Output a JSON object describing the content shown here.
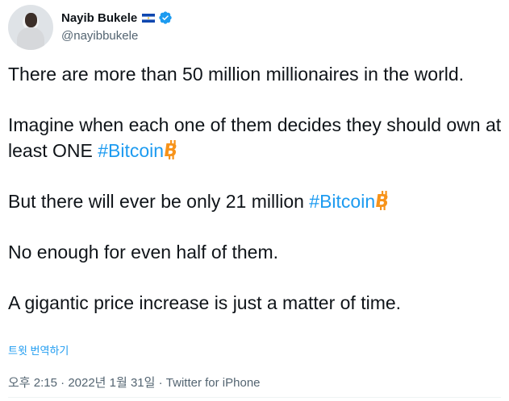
{
  "author": {
    "name": "Nayib Bukele",
    "handle": "@nayibbukele",
    "flag": "el-salvador-flag-icon",
    "verified_icon": "verified-badge-icon"
  },
  "tweet": {
    "paragraph1": "There are more than 50 million millionaires in the world.",
    "paragraph2_text": "Imagine when each one of them decides they should own at least ONE ",
    "paragraph2_hashtag": "#Bitcoin",
    "paragraph3_text": "But there will ever be only 21 million ",
    "paragraph3_hashtag": "#Bitcoin",
    "paragraph4": "No enough for even half of them.",
    "paragraph5": "A gigantic price increase is just a matter of time.",
    "emoji_icon": "bitcoin-icon"
  },
  "translate_label": "트윗 번역하기",
  "meta": {
    "time": "오후 2:15",
    "separator": " · ",
    "date": "2022년 1월 31일",
    "source": "Twitter for iPhone"
  },
  "colors": {
    "link": "#1d9bf0",
    "text": "#0f1419",
    "secondary": "#536471",
    "bitcoin": "#f7931a"
  }
}
